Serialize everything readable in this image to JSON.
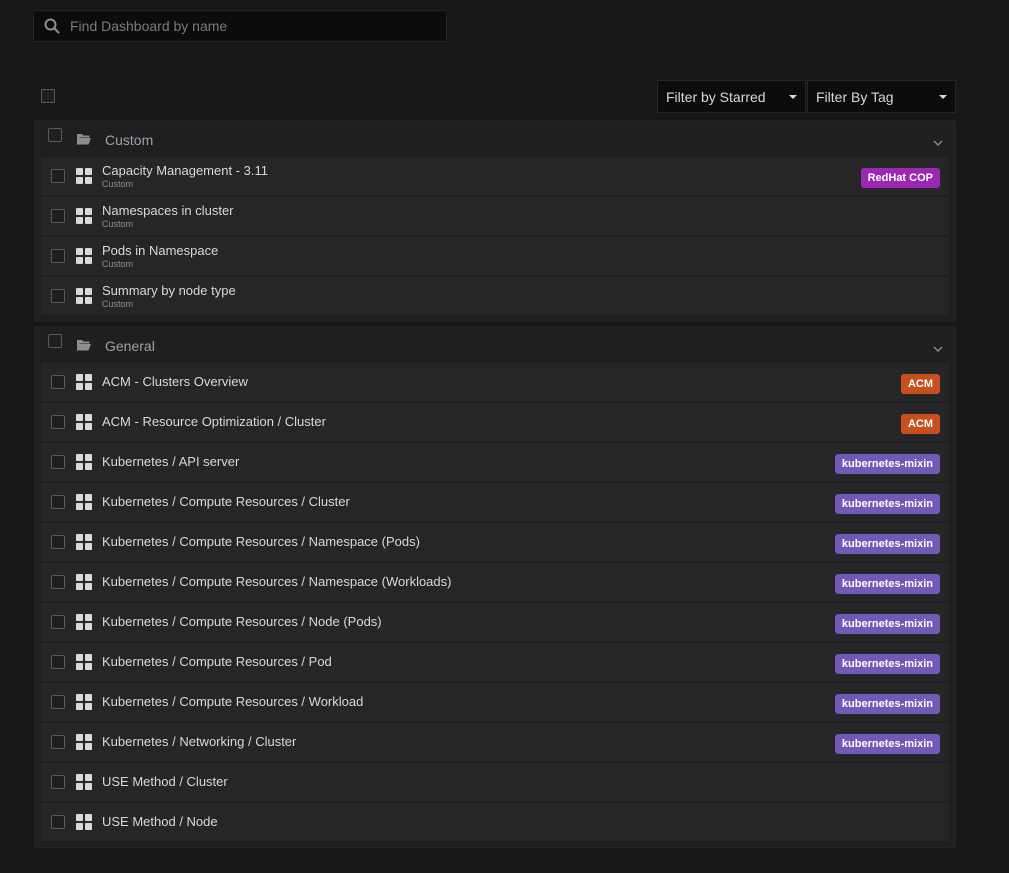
{
  "search": {
    "placeholder": "Find Dashboard by name",
    "value": ""
  },
  "filters": {
    "starred_label": "Filter by Starred",
    "tag_label": "Filter By Tag"
  },
  "folders": [
    {
      "title": "Custom",
      "icon": "folder-open-icon",
      "dashboards": [
        {
          "title": "Capacity Management - 3.11",
          "folder": "Custom",
          "tag": "RedHat COP",
          "tag_color": "#9c27b0"
        },
        {
          "title": "Namespaces in cluster",
          "folder": "Custom"
        },
        {
          "title": "Pods in Namespace",
          "folder": "Custom"
        },
        {
          "title": "Summary by node type",
          "folder": "Custom"
        }
      ]
    },
    {
      "title": "General",
      "icon": "folder-open-icon",
      "dashboards": [
        {
          "title": "ACM - Clusters Overview",
          "tag": "ACM",
          "tag_color": "#c7501e"
        },
        {
          "title": "ACM - Resource Optimization / Cluster",
          "tag": "ACM",
          "tag_color": "#c7501e"
        },
        {
          "title": "Kubernetes / API server",
          "tag": "kubernetes-mixin",
          "tag_color": "#7359b6"
        },
        {
          "title": "Kubernetes / Compute Resources / Cluster",
          "tag": "kubernetes-mixin",
          "tag_color": "#7359b6"
        },
        {
          "title": "Kubernetes / Compute Resources / Namespace (Pods)",
          "tag": "kubernetes-mixin",
          "tag_color": "#7359b6"
        },
        {
          "title": "Kubernetes / Compute Resources / Namespace (Workloads)",
          "tag": "kubernetes-mixin",
          "tag_color": "#7359b6"
        },
        {
          "title": "Kubernetes / Compute Resources / Node (Pods)",
          "tag": "kubernetes-mixin",
          "tag_color": "#7359b6"
        },
        {
          "title": "Kubernetes / Compute Resources / Pod",
          "tag": "kubernetes-mixin",
          "tag_color": "#7359b6"
        },
        {
          "title": "Kubernetes / Compute Resources / Workload",
          "tag": "kubernetes-mixin",
          "tag_color": "#7359b6"
        },
        {
          "title": "Kubernetes / Networking / Cluster",
          "tag": "kubernetes-mixin",
          "tag_color": "#7359b6"
        },
        {
          "title": "USE Method / Cluster"
        },
        {
          "title": "USE Method / Node"
        }
      ]
    }
  ]
}
